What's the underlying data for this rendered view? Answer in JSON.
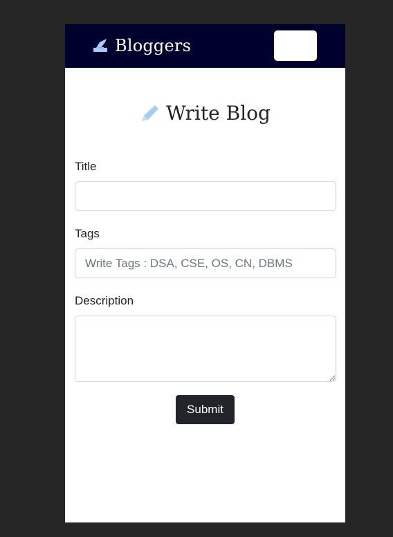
{
  "navbar": {
    "brand_text": "Bloggers",
    "brand_icon": "quill-icon",
    "background_color": "#00002c"
  },
  "page": {
    "heading": "Write Blog",
    "heading_icon": "pencil-icon",
    "accent_color": "#a8cdf5"
  },
  "form": {
    "title_label": "Title",
    "title_value": "",
    "tags_label": "Tags",
    "tags_placeholder": "Write Tags : DSA, CSE, OS, CN, DBMS",
    "tags_value": "",
    "description_label": "Description",
    "description_value": "",
    "submit_label": "Submit"
  }
}
